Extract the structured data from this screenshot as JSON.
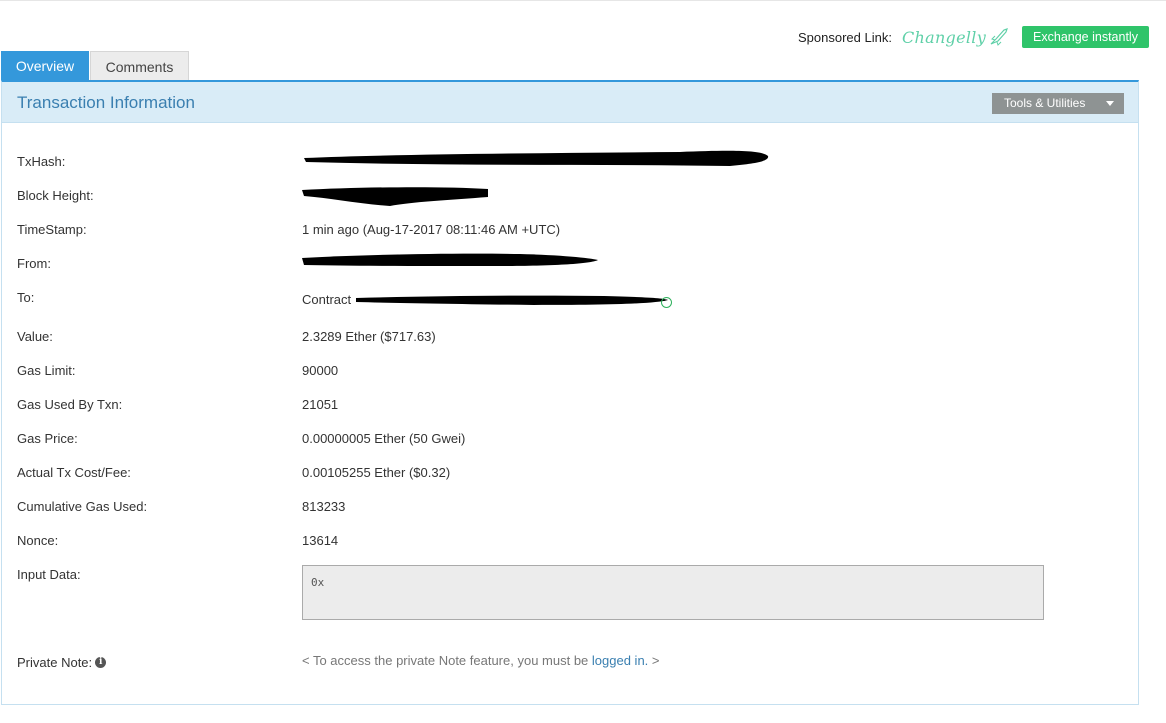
{
  "sponsor": {
    "label": "Sponsored Link:",
    "brand": "Changelly",
    "button": "Exchange instantly",
    "button_color": "#2fc46a"
  },
  "tabs": [
    {
      "label": "Overview",
      "active": true
    },
    {
      "label": "Comments",
      "active": false
    }
  ],
  "panel": {
    "title": "Transaction Information",
    "tools_label": "Tools & Utilities"
  },
  "fields": {
    "txhash": {
      "label": "TxHash:",
      "value": "[redacted]"
    },
    "block_height": {
      "label": "Block Height:",
      "value": "[redacted]"
    },
    "timestamp": {
      "label": "TimeStamp:",
      "value": "1 min ago (Aug-17-2017 08:11:46 AM +UTC)"
    },
    "from": {
      "label": "From:",
      "value": "[redacted]"
    },
    "to": {
      "label": "To:",
      "prefix": "Contract",
      "value": "[redacted]"
    },
    "value": {
      "label": "Value:",
      "value": "2.3289 Ether ($717.63)"
    },
    "gas_limit": {
      "label": "Gas Limit:",
      "value": "90000"
    },
    "gas_used": {
      "label": "Gas Used By Txn:",
      "value": "21051"
    },
    "gas_price": {
      "label": "Gas Price:",
      "value": "0.00000005 Ether (50 Gwei)"
    },
    "tx_fee": {
      "label": "Actual Tx Cost/Fee:",
      "value": "0.00105255 Ether ($0.32)"
    },
    "cumulative_gas": {
      "label": "Cumulative Gas Used:",
      "value": "813233"
    },
    "nonce": {
      "label": "Nonce:",
      "value": "13614"
    },
    "input_data": {
      "label": "Input Data:",
      "value": "0x"
    },
    "private_note": {
      "label": "Private Note:",
      "text_before": "< To access the private Note feature, you must be ",
      "link": "logged in.",
      "text_after": " >"
    }
  },
  "colors": {
    "accent": "#3498db",
    "header_bg": "#d9ecf7",
    "link": "#3a7fb0"
  }
}
